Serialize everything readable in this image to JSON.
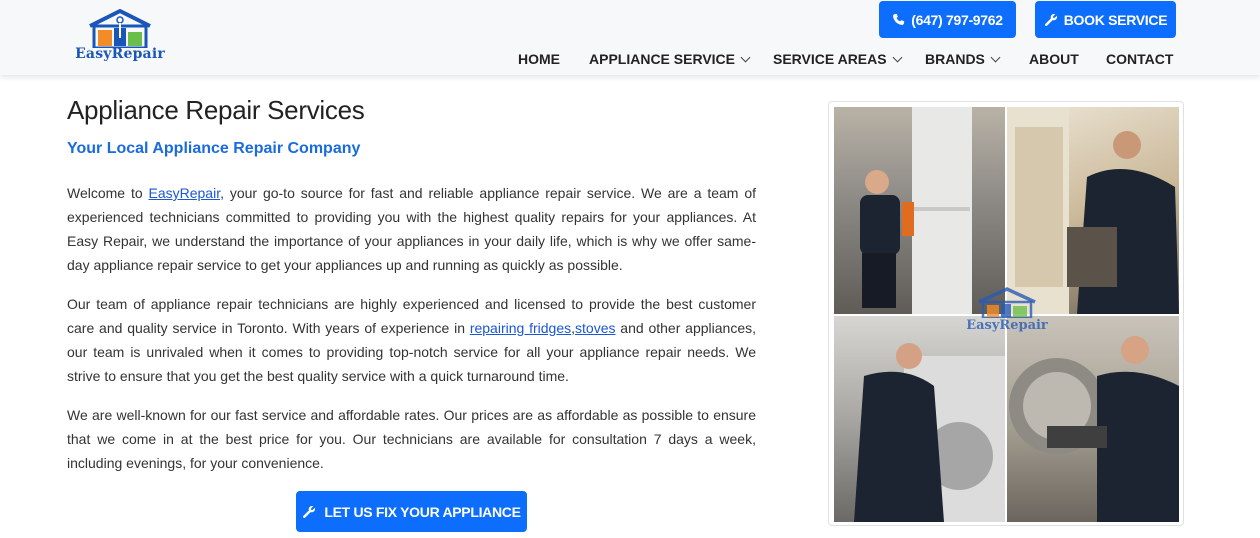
{
  "brand": {
    "logo_text": "EasyRepair",
    "colors": {
      "primary": "#0d6efd",
      "subtitle": "#1a6bdc",
      "link": "#1a56d6",
      "logo_blue": "#1a56b8",
      "logo_orange": "#f28c28",
      "logo_green": "#6abf4b"
    }
  },
  "header": {
    "phone_button": {
      "label": "(647) 797-9762",
      "icon": "phone-icon"
    },
    "book_button": {
      "label": "BOOK SERVICE",
      "icon": "wrench-icon"
    },
    "nav": [
      {
        "label": "HOME",
        "has_dropdown": false
      },
      {
        "label": "APPLIANCE SERVICE",
        "has_dropdown": true
      },
      {
        "label": "SERVICE AREAS",
        "has_dropdown": true
      },
      {
        "label": "BRANDS",
        "has_dropdown": true
      },
      {
        "label": "ABOUT",
        "has_dropdown": false
      },
      {
        "label": "CONTACT",
        "has_dropdown": false
      }
    ]
  },
  "main": {
    "title": "Appliance Repair Services",
    "subtitle": "Your Local Appliance Repair Company",
    "p1": {
      "before": "Welcome to ",
      "link": "EasyRepair",
      "after": ", your go-to source for fast and reliable appliance repair service. We are a team of experienced technicians committed to providing you with the highest quality repairs for your appliances. At Easy Repair, we understand the importance of your appliances in your daily life, which is why we offer same-day appliance repair service to get your appliances up and running as quickly as possible."
    },
    "p2": {
      "before": "Our team of appliance repair technicians are highly experienced and licensed to provide the best customer care and quality service in Toronto. With years of experience in ",
      "link1": "repairing fridges",
      "sep": ",",
      "link2": "stoves",
      "after": " and other appliances, our team is unrivaled when it comes to providing top-notch service for all your appliance repair needs. We strive to ensure that you get the best quality service with a quick turnaround time."
    },
    "p3": "We are well-known for our fast service and affordable rates. Our prices are as affordable as possible to ensure that we come in at the best price for you. Our technicians are available for consultation 7 days a week, including evenings, for your convenience.",
    "cta": {
      "label": "LET US FIX YOUR APPLIANCE",
      "icon": "wrench-icon"
    }
  },
  "collage": {
    "watermark_text": "EasyRepair"
  }
}
